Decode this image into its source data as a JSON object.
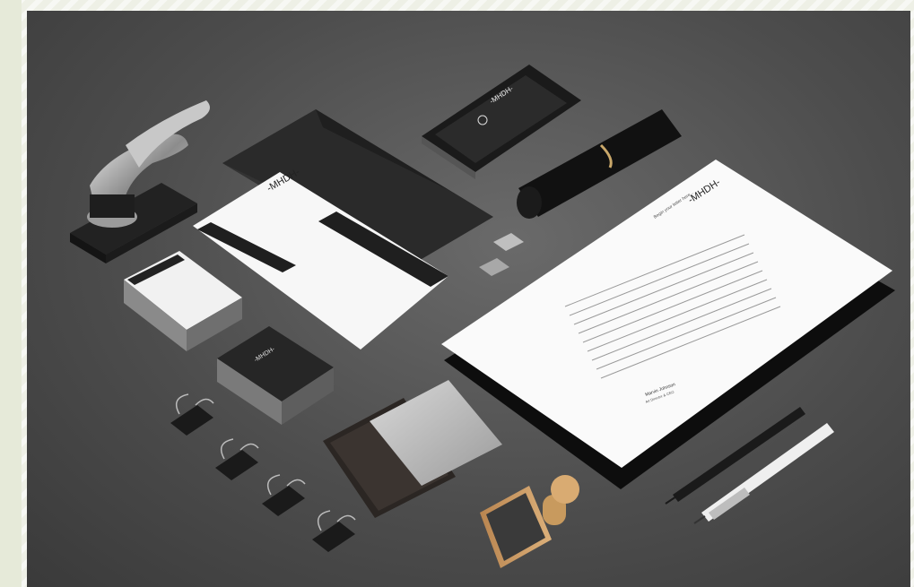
{
  "brand": {
    "logo_text": "-MHDH-",
    "signature_name": "Marvin Johnson",
    "signature_role": "Art Director & CEO",
    "greeting": "Begin your letter here..."
  },
  "colors": {
    "background": "#4d4d4d",
    "paper": "#ffffff",
    "black": "#1c1c1c",
    "wood": "#c89a5e"
  },
  "objects": [
    "embosser-icon",
    "envelope",
    "phone",
    "pencil-bundle",
    "sharpeners",
    "letterhead",
    "business-cards",
    "binder-clips",
    "ink-pad",
    "rubber-stamp",
    "pens"
  ]
}
